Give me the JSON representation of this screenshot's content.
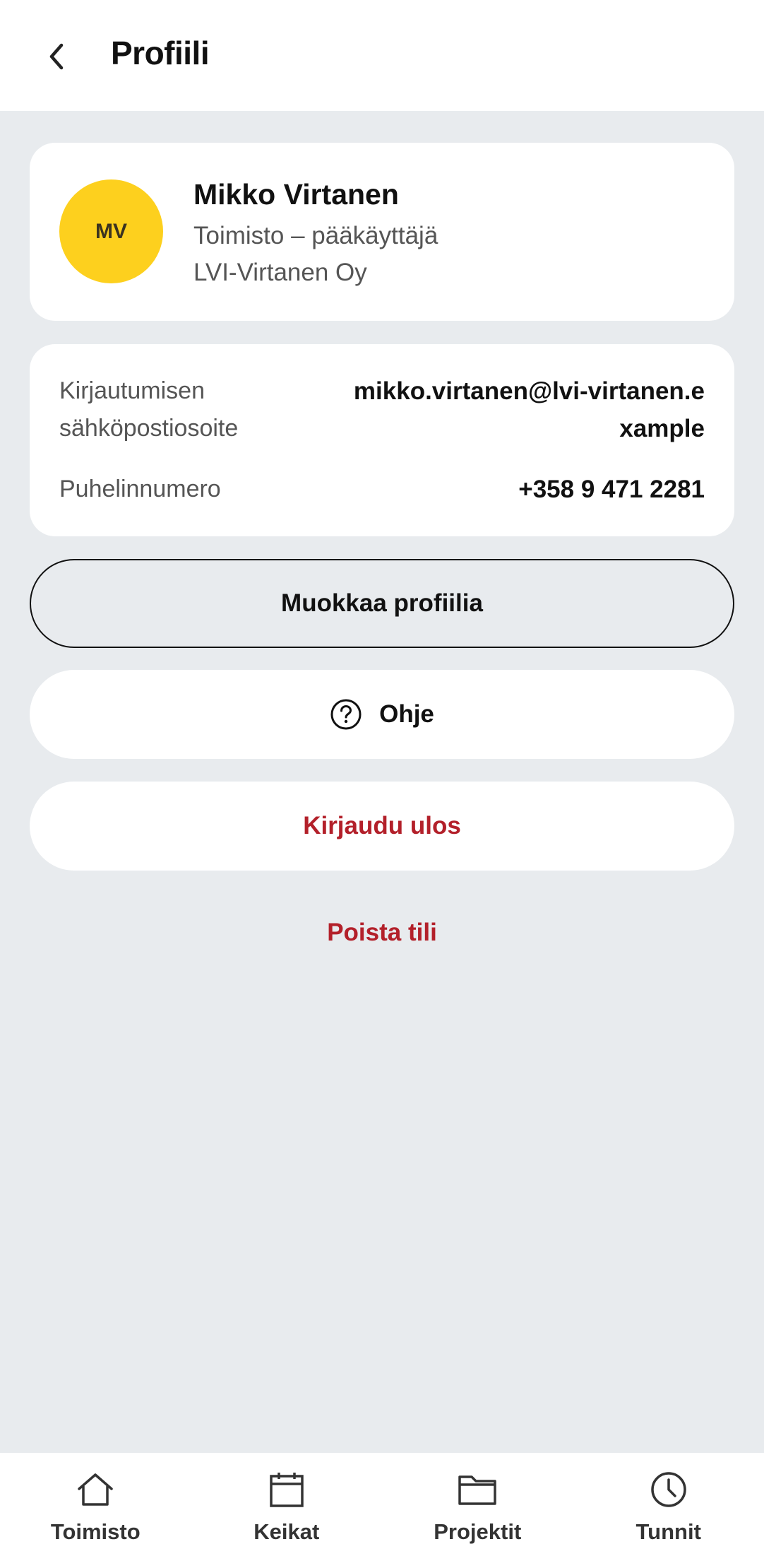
{
  "header": {
    "title": "Profiili",
    "back_icon": "chevron-left-icon"
  },
  "profile": {
    "initials": "MV",
    "name": "Mikko Virtanen",
    "role": "Toimisto – pääkäyttäjä",
    "company": "LVI-Virtanen Oy",
    "avatar_color": "#fdd01e"
  },
  "info": {
    "email_label": "Kirjautumisen sähköpostiosoite",
    "email_value": "mikko.virtanen@lvi-virtanen.example",
    "phone_label": "Puhelinnumero",
    "phone_value": "+358 9 471 2281"
  },
  "actions": {
    "edit_label": "Muokkaa profiilia",
    "help_label": "Ohje",
    "logout_label": "Kirjaudu ulos",
    "delete_label": "Poista tili",
    "danger_color": "#b3202a"
  },
  "nav": {
    "items": [
      {
        "label": "Toimisto",
        "icon": "home-icon"
      },
      {
        "label": "Keikat",
        "icon": "calendar-icon"
      },
      {
        "label": "Projektit",
        "icon": "folder-icon"
      },
      {
        "label": "Tunnit",
        "icon": "clock-icon"
      }
    ]
  }
}
